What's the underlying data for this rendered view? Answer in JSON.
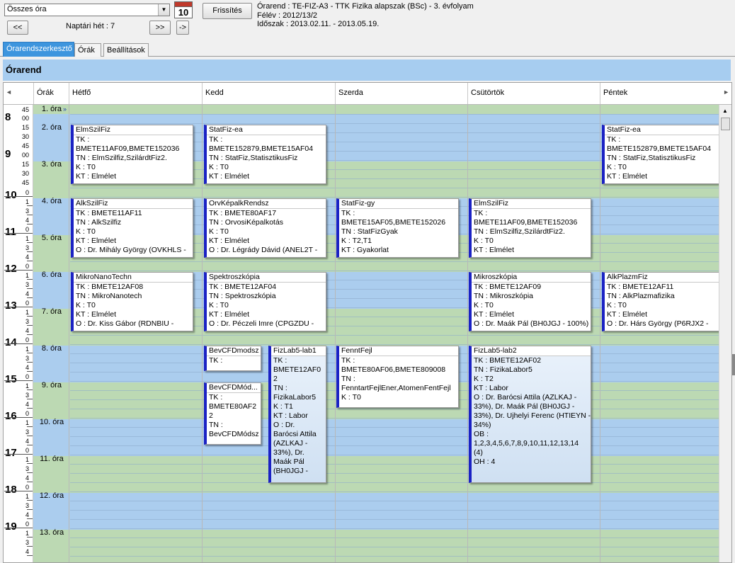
{
  "toolbar": {
    "period_select": "Összes óra",
    "calendar_day": "10",
    "refresh": "Frissítés",
    "prev": "<<",
    "next": ">>",
    "go": "->",
    "week": "Naptári hét : 7"
  },
  "info": {
    "line1": "Órarend : TE-FIZ-A3 - TTK Fizika alapszak (BSc) - 3. évfolyam",
    "line2": "Félév : 2012/13/2",
    "line3": "Időszak : 2013.02.11. - 2013.05.19."
  },
  "tabs": [
    "Órarendszerkesztő",
    "Órák",
    "Beállítások"
  ],
  "title": "Órarend",
  "headers": {
    "lessons": "Órák",
    "days": [
      "Hétfő",
      "Kedd",
      "Szerda",
      "Csütörtök",
      "Péntek"
    ]
  },
  "hours": [
    "8",
    "9",
    "10",
    "11",
    "12",
    "13",
    "14",
    "15",
    "16",
    "17",
    "18",
    "19"
  ],
  "lessons": [
    "1. óra",
    "2. óra",
    "3. óra",
    "4. óra",
    "5. óra",
    "6. óra",
    "7. óra",
    "8. óra",
    "9. óra",
    "10. óra",
    "11. óra",
    "12. óra",
    "13. óra"
  ],
  "time_labels": {
    "quarters": [
      "45",
      "00",
      "15",
      "30",
      "45",
      "00",
      "15",
      "30",
      "45"
    ],
    "minor": [
      "0",
      "1",
      "3",
      "4"
    ]
  },
  "events": [
    {
      "title": "ElmSzilFiz",
      "lines": [
        "TK :",
        "BMETE11AF09,BMETE152036",
        "TN : ElmSzilfiz,SzilárdtFiz2.",
        "K : T0",
        "KT : Elmélet"
      ]
    },
    {
      "title": "StatFiz-ea",
      "lines": [
        "TK :",
        "BMETE152879,BMETE15AF04",
        "TN : StatFiz,StatisztikusFiz",
        "K : T0",
        "KT : Elmélet"
      ]
    },
    {
      "title": "StatFiz-ea",
      "lines": [
        "TK :",
        "BMETE152879,BMETE15AF04",
        "TN : StatFiz,StatisztikusFiz",
        "K : T0",
        "KT : Elmélet"
      ]
    },
    {
      "title": "AlkSzilFiz",
      "lines": [
        "TK : BMETE11AF11",
        "TN : AlkSzilfiz",
        "K : T0",
        "KT : Elmélet",
        "O : Dr. Mihály György (OVKHLS -"
      ]
    },
    {
      "title": "OrvKépalkRendsz",
      "lines": [
        "TK : BMETE80AF17",
        "TN : OrvosiKépalkotás",
        "K : T0",
        "KT : Elmélet",
        "O : Dr. Légrády Dávid (ANEL2T -"
      ]
    },
    {
      "title": "StatFiz-gy",
      "lines": [
        "TK :",
        "BMETE15AF05,BMETE152026",
        "TN : StatFizGyak",
        "K : T2,T1",
        "KT : Gyakorlat"
      ]
    },
    {
      "title": "ElmSzilFiz",
      "lines": [
        "TK :",
        "BMETE11AF09,BMETE152036",
        "TN : ElmSzilfiz,SzilárdtFiz2.",
        "K : T0",
        "KT : Elmélet"
      ]
    },
    {
      "title": "MikroNanoTechn",
      "lines": [
        "TK : BMETE12AF08",
        "TN : MikroNanotech",
        "K : T0",
        "KT : Elmélet",
        "O : Dr. Kiss Gábor (RDNBIU -"
      ]
    },
    {
      "title": "Spektroszkópia",
      "lines": [
        "TK : BMETE12AF04",
        "TN : Spektroszkópia",
        "K : T0",
        "KT : Elmélet",
        "O : Dr. Péczeli Imre (CPGZDU -"
      ]
    },
    {
      "title": "Mikroszkópia",
      "lines": [
        "TK : BMETE12AF09",
        "TN : Mikroszkópia",
        "K : T0",
        "KT : Elmélet",
        "O : Dr. Maák Pál (BH0JGJ - 100%)"
      ]
    },
    {
      "title": "AlkPlazmFiz",
      "lines": [
        "TK : BMETE12AF11",
        "TN : AlkPlazmafizika",
        "K : T0",
        "KT : Elmélet",
        "O : Dr. Hárs György (P6RJX2 -"
      ]
    },
    {
      "title": "BevCFDmodsz",
      "lines": [
        "TK :"
      ]
    },
    {
      "title": "BevCFDMód...",
      "lines": [
        "TK :",
        "BMETE80AF2",
        "2",
        "TN :",
        "BevCFDMódsz"
      ]
    },
    {
      "title": "FizLab5-lab1",
      "lines": [
        "TK :",
        "BMETE12AF0",
        "2",
        "TN :",
        "FizikaLabor5",
        "K : T1",
        "KT : Labor",
        "O : Dr.",
        "Barócsi Attila",
        "(AZLKAJ -",
        "33%), Dr.",
        "Maák Pál",
        "(BH0JGJ -"
      ]
    },
    {
      "title": "FenntFejl",
      "lines": [
        "TK :",
        "BMETE80AF06,BMETE809008",
        "TN :",
        "FenntartFejlEner,AtomenFentFejl",
        "K : T0"
      ]
    },
    {
      "title": "FizLab5-lab2",
      "lines": [
        "TK : BMETE12AF02",
        "TN : FizikaLabor5",
        "K : T2",
        "KT : Labor",
        "O : Dr. Barócsi Attila (AZLKAJ -",
        "33%), Dr. Maák Pál (BH0JGJ -",
        "33%), Dr. Ujhelyi Ferenc (HTIEYN -",
        "34%)",
        "OB :",
        "1,2,3,4,5,6,7,8,9,10,11,12,13,14",
        "(4)",
        "OH : 4"
      ]
    }
  ]
}
